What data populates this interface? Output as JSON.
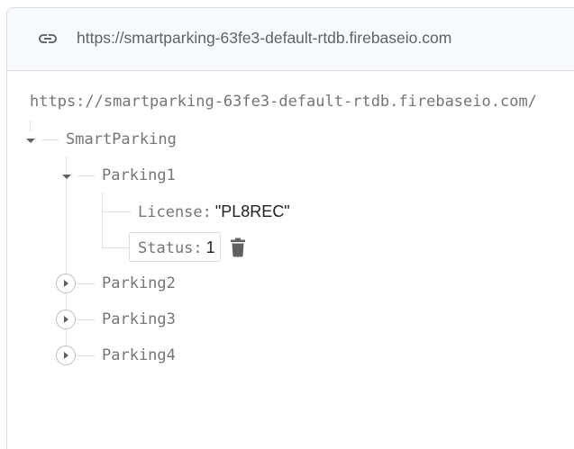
{
  "url_bar": {
    "url": "https://smartparking-63fe3-default-rtdb.firebaseio.com",
    "icon": "link-icon"
  },
  "tree": {
    "root_url": "https://smartparking-63fe3-default-rtdb.firebaseio.com/",
    "root_node": "SmartParking",
    "expanded_node": {
      "name": "Parking1",
      "fields": [
        {
          "key": "License:",
          "value": "\"PL8REC\""
        },
        {
          "key": "Status:",
          "value": "1"
        }
      ]
    },
    "collapsed_nodes": [
      "Parking2",
      "Parking3",
      "Parking4"
    ]
  },
  "icons": {
    "delete": "trash-icon",
    "expand": "expand-arrow-icon",
    "collapse": "collapse-arrow-icon"
  },
  "colors": {
    "url_bar_bg": "#f8f9fa",
    "border": "#dadce0",
    "key_text": "#757575",
    "value_text": "#212121",
    "icon": "#616161"
  }
}
